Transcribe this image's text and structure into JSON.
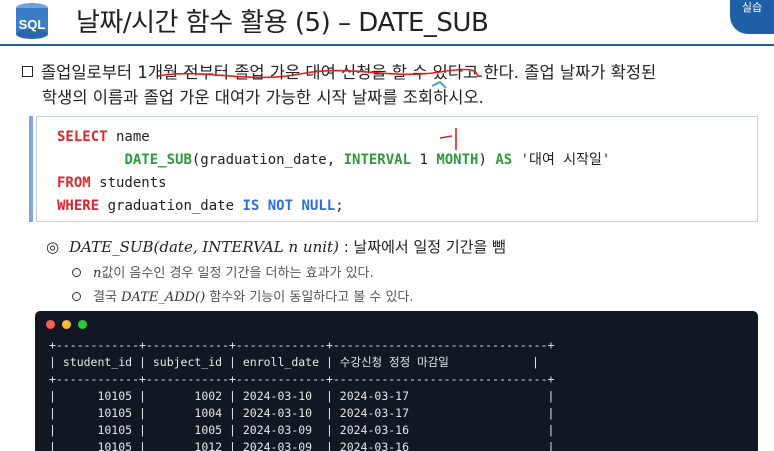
{
  "header": {
    "icon_label": "SQL",
    "title": "날짜/시간 함수 활용 (5) – DATE_SUB",
    "corner_tag": "실습"
  },
  "intro": {
    "line1": "졸업일로부터 1개월 전부터 졸업 가운 대여 신청을 할 수 있다고 한다. 졸업 날짜가 확정된",
    "line2": "학생의 이름과 졸업 가운 대여가 가능한 시작 날짜를 조회하시오."
  },
  "code": {
    "select_kw": "SELECT",
    "select_col": " name",
    "fn_name": "DATE_SUB",
    "fn_args_a": "(graduation_date, ",
    "interval_kw": "INTERVAL",
    "interval_num": " 1 ",
    "month_kw": "MONTH",
    "fn_close": ") ",
    "as_kw": "AS",
    "alias": " '대여 시작일'",
    "from_kw": "FROM",
    "from_table": " students",
    "where_kw": "WHERE",
    "where_col": " graduation_date ",
    "is_kw": "IS",
    "not_kw": "NOT",
    "null_kw": "NULL",
    "semicolon": ";"
  },
  "notes": {
    "main_bullet": "◎",
    "main_fn": "DATE_SUB(date, INTERVAL n unit)",
    "main_desc": " : 날짜에서 일정 기간을 뺌",
    "sub1_var": "n",
    "sub1_text": "값이 음수인 경우 일정 기간을 더하는 효과가 있다.",
    "sub2_pre": "결국 ",
    "sub2_fn": "DATE_ADD()",
    "sub2_post": " 함수와 기능이 동일하다고 볼 수 있다."
  },
  "terminal": {
    "border": "+------------+------------+-------------+-------------------------------+",
    "header": "| student_id | subject_id | enroll_date | 수강신청 정정 마감일            |",
    "rows": [
      "|      10105 |       1002 | 2024-03-10  | 2024-03-17                    |",
      "|      10105 |       1004 | 2024-03-10  | 2024-03-17                    |",
      "|      10105 |       1005 | 2024-03-09  | 2024-03-16                    |",
      "|      10105 |       1012 | 2024-03-09  | 2024-03-16                    |"
    ]
  },
  "colors": {
    "accent": "#1f5fa8",
    "keyword_red": "#e0242b",
    "keyword_green": "#2e9a3c",
    "keyword_blue": "#2c6fd6",
    "terminal_bg": "#121823",
    "annotation_red": "#e02020"
  }
}
